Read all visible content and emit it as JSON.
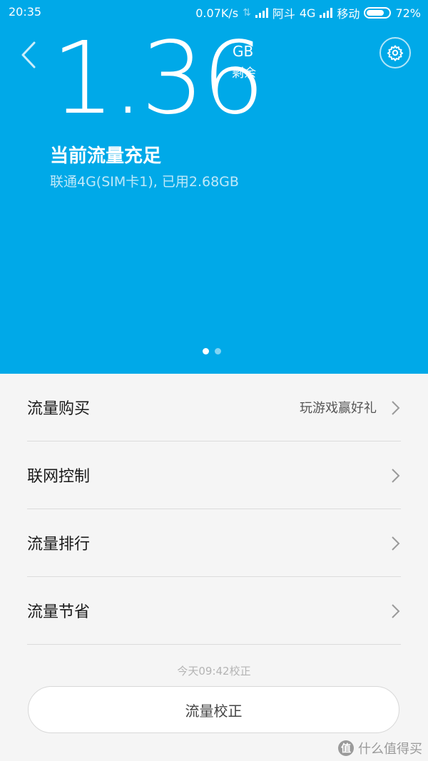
{
  "status_bar": {
    "time": "20:35",
    "net_speed": "0.07K/s",
    "carrier1": "阿斗",
    "network1": "4G",
    "carrier2": "移动",
    "battery": "72%"
  },
  "icons": {
    "back": "chevron-left-icon",
    "settings": "gear-icon",
    "row_arrow": "chevron-right-icon"
  },
  "hero": {
    "remaining_value": "1.36",
    "unit": "GB",
    "unit_label": "剩余",
    "status_title": "当前流量充足",
    "status_detail": "联通4G(SIM卡1), 已用2.68GB",
    "page_count": 2,
    "active_page": 1
  },
  "menu": {
    "items": [
      {
        "label": "流量购买",
        "extra": "玩游戏赢好礼"
      },
      {
        "label": "联网控制"
      },
      {
        "label": "流量排行"
      },
      {
        "label": "流量节省"
      }
    ]
  },
  "calibration": {
    "last_time": "今天09:42校正",
    "button_label": "流量校正"
  },
  "watermark": {
    "logo_char": "值",
    "text": "什么值得买"
  },
  "colors": {
    "hero_bg": "#00a9e8",
    "page_bg": "#f5f5f5"
  }
}
